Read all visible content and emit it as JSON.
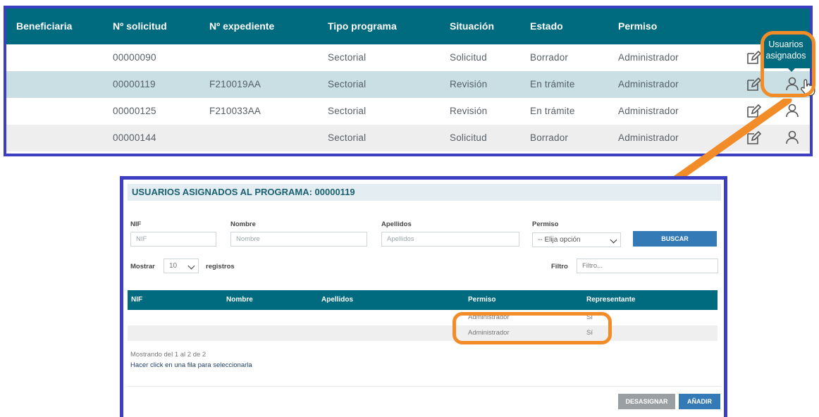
{
  "top_table": {
    "headers": [
      "Beneficiaria",
      "Nº solicitud",
      "Nº expediente",
      "Tipo programa",
      "Situación",
      "Estado",
      "Permiso"
    ],
    "rows": [
      {
        "solicitud": "00000090",
        "expediente": "",
        "tipo": "Sectorial",
        "situacion": "Solicitud",
        "estado": "Borrador",
        "permiso": "Administrador"
      },
      {
        "solicitud": "00000119",
        "expediente": "F210019AA",
        "tipo": "Sectorial",
        "situacion": "Revisión",
        "estado": "En trámite",
        "permiso": "Administrador"
      },
      {
        "solicitud": "00000125",
        "expediente": "F210033AA",
        "tipo": "Sectorial",
        "situacion": "Revisión",
        "estado": "En trámite",
        "permiso": "Administrador"
      },
      {
        "solicitud": "00000144",
        "expediente": "",
        "tipo": "Sectorial",
        "situacion": "Solicitud",
        "estado": "Borrador",
        "permiso": "Administrador"
      }
    ],
    "tooltip_line1": "Usuarios",
    "tooltip_line2": "asignados",
    "icons": [
      "edit-icon",
      "user-icon",
      "pointer-hand-icon"
    ]
  },
  "modal": {
    "title": "USUARIOS ASIGNADOS AL PROGRAMA: 00000119",
    "filters": {
      "nif_label": "NIF",
      "nif_placeholder": "NIF",
      "nombre_label": "Nombre",
      "nombre_placeholder": "Nombre",
      "apellidos_label": "Apellidos",
      "apellidos_placeholder": "Apellidos",
      "permiso_label": "Permiso",
      "permiso_value": "-- Elija opción",
      "search_button": "BUSCAR"
    },
    "show_label": "Mostrar",
    "show_value": "10",
    "records_label": "registros",
    "filter_label": "Filtro",
    "filter_placeholder": "Filtro...",
    "table": {
      "headers": [
        "NIF",
        "Nombre",
        "Apellidos",
        "Permiso",
        "Representante"
      ],
      "rows": [
        {
          "nif": "",
          "nombre": "",
          "apellidos": "",
          "permiso": "Administrador",
          "representante": "Sí"
        },
        {
          "nif": "",
          "nombre": "",
          "apellidos": "",
          "permiso": "Administrador",
          "representante": "Sí"
        }
      ]
    },
    "showing_text": "Mostrando del 1 al 2 de 2",
    "hint_text": "Hacer click en una fila para seleccionarla",
    "unassign_button": "DESASIGNAR",
    "add_button": "AÑADIR"
  },
  "colors": {
    "header_teal": "#006a7e",
    "highlight_row": "#c9dfe4",
    "frame_blue": "#3d3fc2",
    "callout_orange": "#f28c28",
    "button_blue": "#337ab7",
    "button_gray": "#9a9fa3"
  }
}
